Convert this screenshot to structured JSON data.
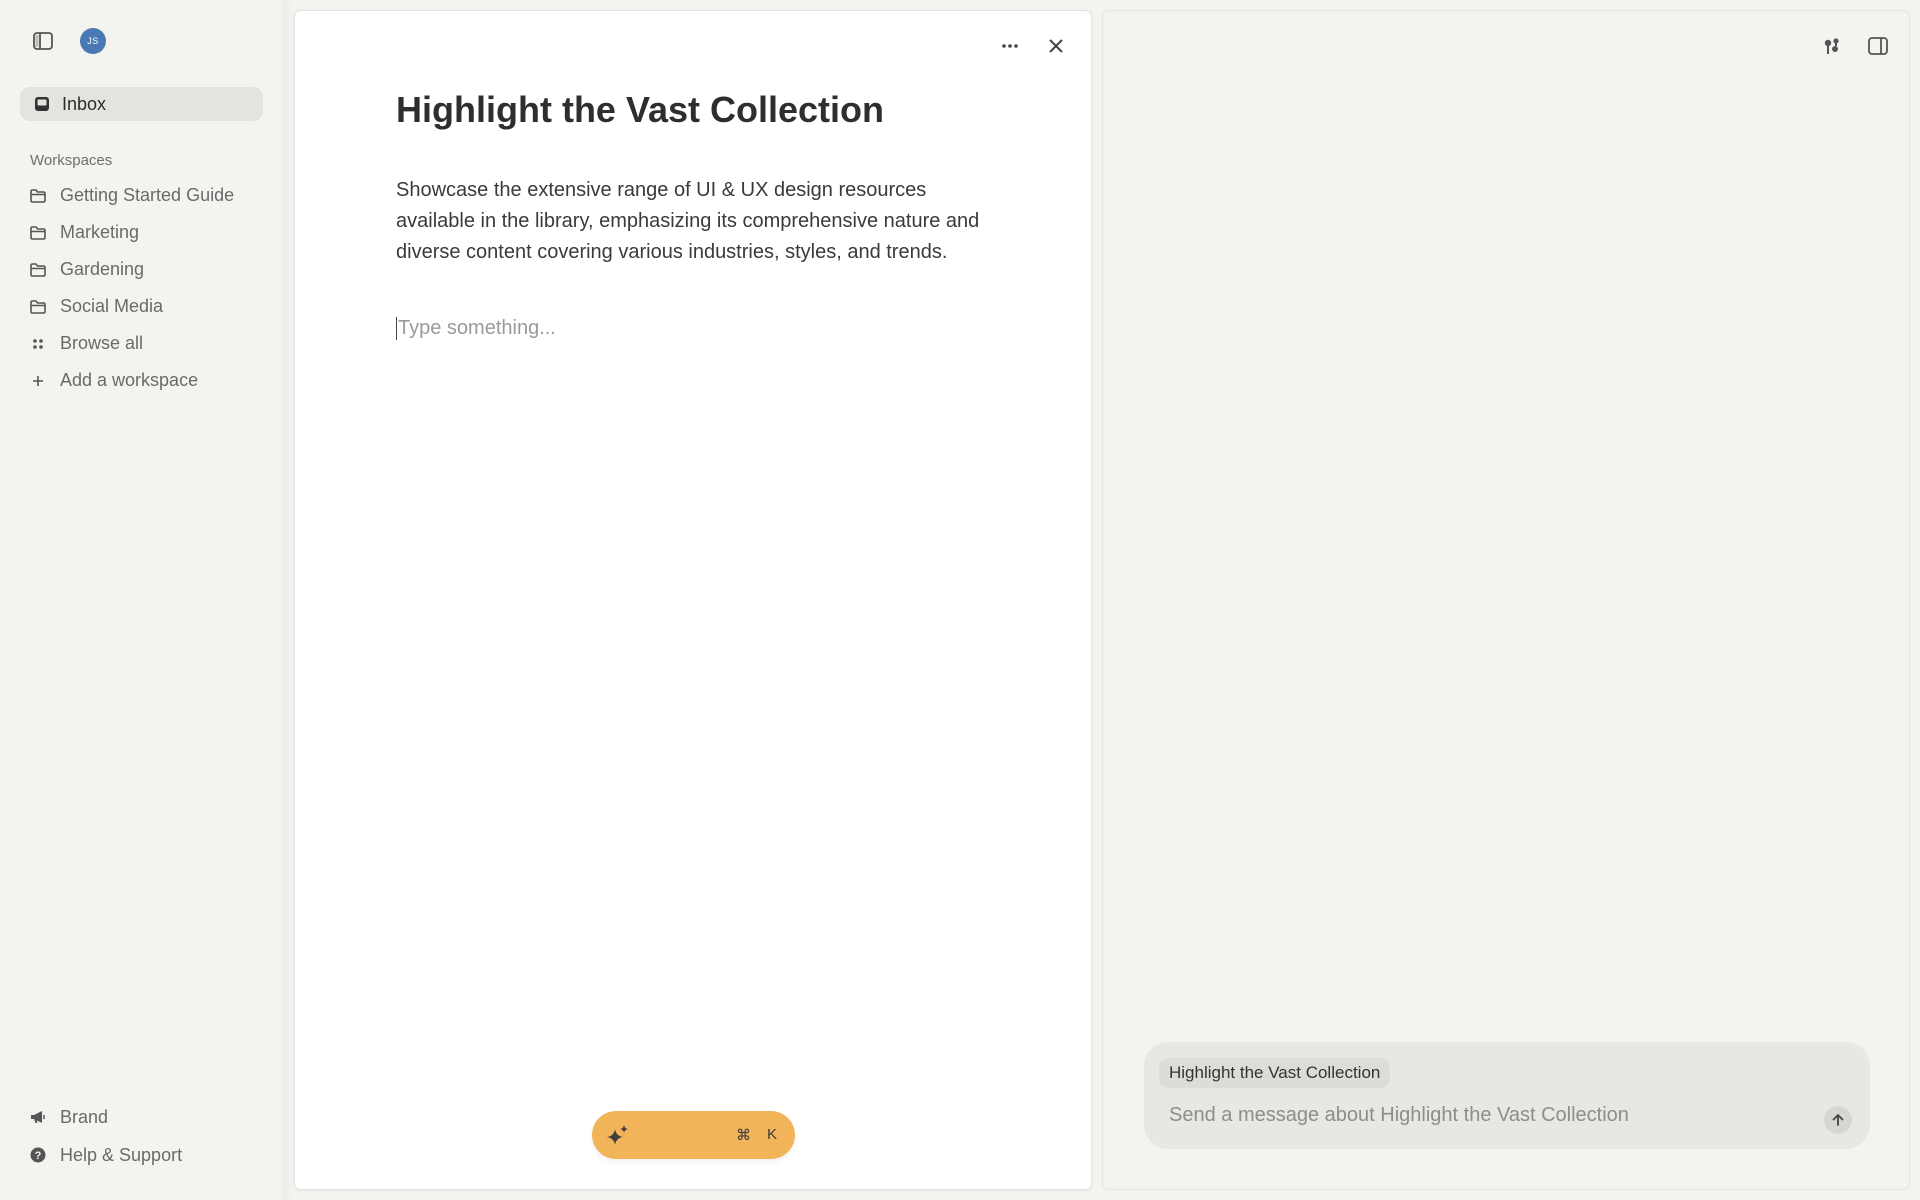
{
  "sidebar": {
    "avatar_initials": "JS",
    "inbox_label": "Inbox",
    "workspaces_title": "Workspaces",
    "workspaces": [
      {
        "label": "Getting Started Guide",
        "icon": "folder-icon"
      },
      {
        "label": "Marketing",
        "icon": "folder-icon"
      },
      {
        "label": "Gardening",
        "icon": "folder-icon"
      },
      {
        "label": "Social Media",
        "icon": "folder-icon"
      }
    ],
    "browse_all": "Browse all",
    "add_workspace": "Add a workspace",
    "bottom": {
      "brand": "Brand",
      "help": "Help & Support"
    }
  },
  "document": {
    "title": "Highlight the Vast Collection",
    "body": "Showcase the extensive range of UI & UX design resources available in the library, emphasizing its comprehensive nature and diverse content covering various industries, styles, and trends.",
    "input_placeholder": "Type something...",
    "ai_shortcut": {
      "cmd": "⌘",
      "key": "K"
    }
  },
  "chat": {
    "context_chip": "Highlight the Vast Collection",
    "input_placeholder": "Send a message about Highlight the Vast Collection"
  },
  "colors": {
    "accent": "#f1b459",
    "avatar": "#4a78b5",
    "background": "#f3f3ef"
  }
}
